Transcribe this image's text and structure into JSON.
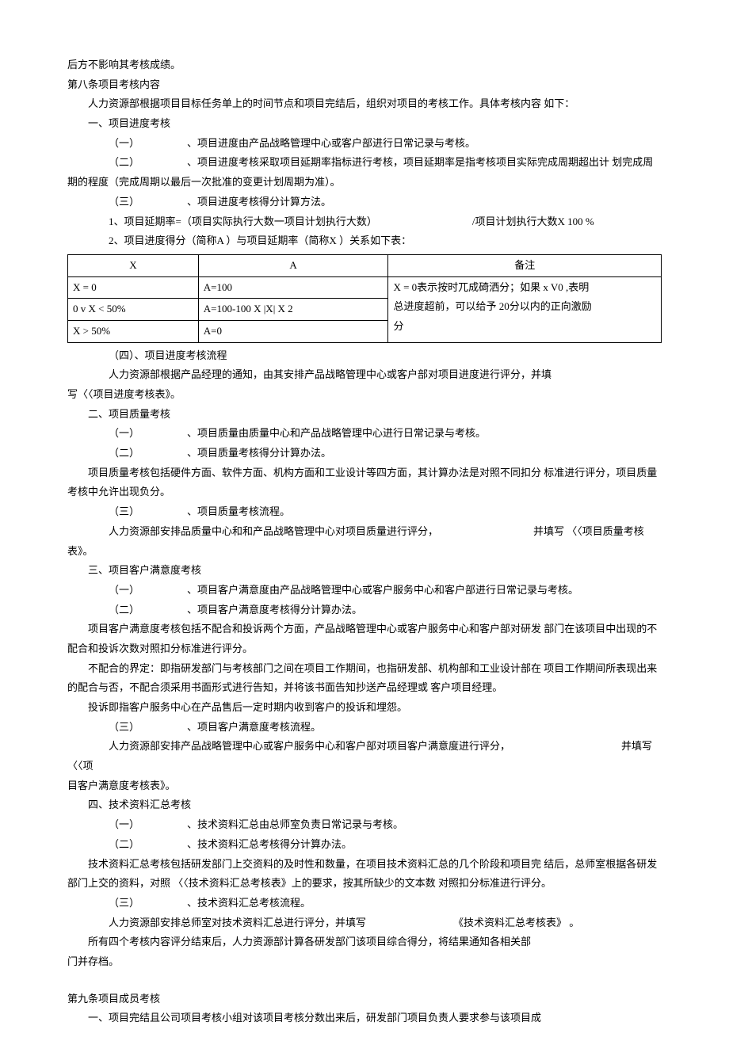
{
  "p1": "后方不影响其考核成绩。",
  "p2": "第八条项目考核内容",
  "p3": "人力资源部根据项目目标任务单上的时间节点和项目完结后，组织对项目的考核工作。具体考核内容 如下：",
  "p4": "一、项目进度考核",
  "p5a": "（一）",
  "p5b": "、项目进度由产品战略管理中心或客户部进行日常记录与考核。",
  "p6a": "（二）",
  "p6b": "、项目进度考核采取项目延期率指标进行考核，项目延期率是指考核项目实际完成周期超出计 划完成周期的程度（完成周期以最后一次批准的变更计划周期为准）。",
  "p7a": "（三）",
  "p7b": "、项目进度考核得分计算方法。",
  "p8a": "1、",
  "p8b": "项目延期率=（项目实际执行大数一项目计划执行大数）",
  "p8c": "/项目计划执行大数X 100 %",
  "p9a": "2、",
  "p9b": "项目进度得分（简称A ）与项目延期率（简称X ）关系如下表：",
  "table": {
    "headers": [
      "X",
      "A",
      "备注"
    ],
    "rows": [
      [
        "X = 0",
        "A=100"
      ],
      [
        "0 v X < 50%",
        "A=100-100 X |X| X 2"
      ],
      [
        "X > 50%",
        "A=0"
      ]
    ],
    "note1": "X = 0表示按时兀成碕洒分；如果 x V0 ,表明",
    "note2": "总进度超前，可以给予 20分以内的正向激励",
    "note3": "分"
  },
  "p10": "（四）、项目进度考核流程",
  "p11": "人力资源部根据产品经理的通知，由其安排产品战略管理中心或客户部对项目进度进行评分，并填",
  "p12": "写〈〈项目进度考核表》。",
  "p13": "二、项目质量考核",
  "p14a": "（一）",
  "p14b": "、项目质量由质量中心和产品战略管理中心进行日常记录与考核。",
  "p15a": "（二）",
  "p15b": "、项目质量考核得分计算办法。",
  "p16": "项目质量考核包括硬件方面、软件方面、机构方面和工业设计等四方面，其计算办法是对照不同扣分 标准进行评分，项目质量考核中允许出现负分。",
  "p17a": "（三）",
  "p17b": "、项目质量考核流程。",
  "p18a": "人力资源部安排品质量中心和和产品战略管理中心对项目质量进行评分，",
  "p18b": "并填写 〈〈项目质量考核表》。",
  "p19": "三、项目客户满意度考核",
  "p20a": "（一）",
  "p20b": "、项目客户满意度由产品战略管理中心或客户服务中心和客户部进行日常记录与考核。",
  "p21a": "（二）",
  "p21b": "、项目客户满意度考核得分计算办法。",
  "p22": "项目客户满意度考核包括不配合和投诉两个方面，产品战略管理中心或客户服务中心和客户部对研发 部门在该项目中出现的不配合和投诉次数对照扣分标准进行评分。",
  "p23": "不配合的界定：即指研发部门与考核部门之间在项目工作期间，也指研发部、机构部和工业设计部在 项目工作期间所表现出来的配合与否，不配合须采用书面形式进行告知，并将该书面告知抄送产品经理或 客户项目经理。",
  "p24": "投诉即指客户服务中心在产品售后一定时期内收到客户的投诉和埋怨。",
  "p25a": "（三）",
  "p25b": "、项目客户满意度考核流程。",
  "p26a": "人力资源部安排产品战略管理中心或客户服务中心和客户部对项目客户满意度进行评分，",
  "p26b": "并填写 〈〈项",
  "p27": "目客户满意度考核表》。",
  "p28": "四、技术资料汇总考核",
  "p29a": "（一）",
  "p29b": "、技术资料汇总由总师室负责日常记录与考核。",
  "p30a": "（二）",
  "p30b": "、技术资料汇总考核得分计算办法。",
  "p31": "技术资料汇总考核包括研发部门上交资料的及时性和数量，在项目技术资料汇总的几个阶段和项目完 结后，总师室根据各研发部门上交的资料，对照 〈〈技术资料汇总考核表》上的要求，按其所缺少的文本数 对照扣分标准进行评分。",
  "p32a": "（三）",
  "p32b": "、技术资料汇总考核流程。",
  "p33a": "人力资源部安排总师室对技术资料汇总进行评分，并填写",
  "p33b": "《技术资料汇总考核表》 。",
  "p34": "所有四个考核内容评分结束后，人力资源部计算各研发部门该项目综合得分，将结果通知各相关部",
  "p35": "门并存档。",
  "p36": "第九条项目成员考核",
  "p37": "一、项目完结且公司项目考核小组对该项目考核分数出来后，研发部门项目负责人要求参与该项目成"
}
